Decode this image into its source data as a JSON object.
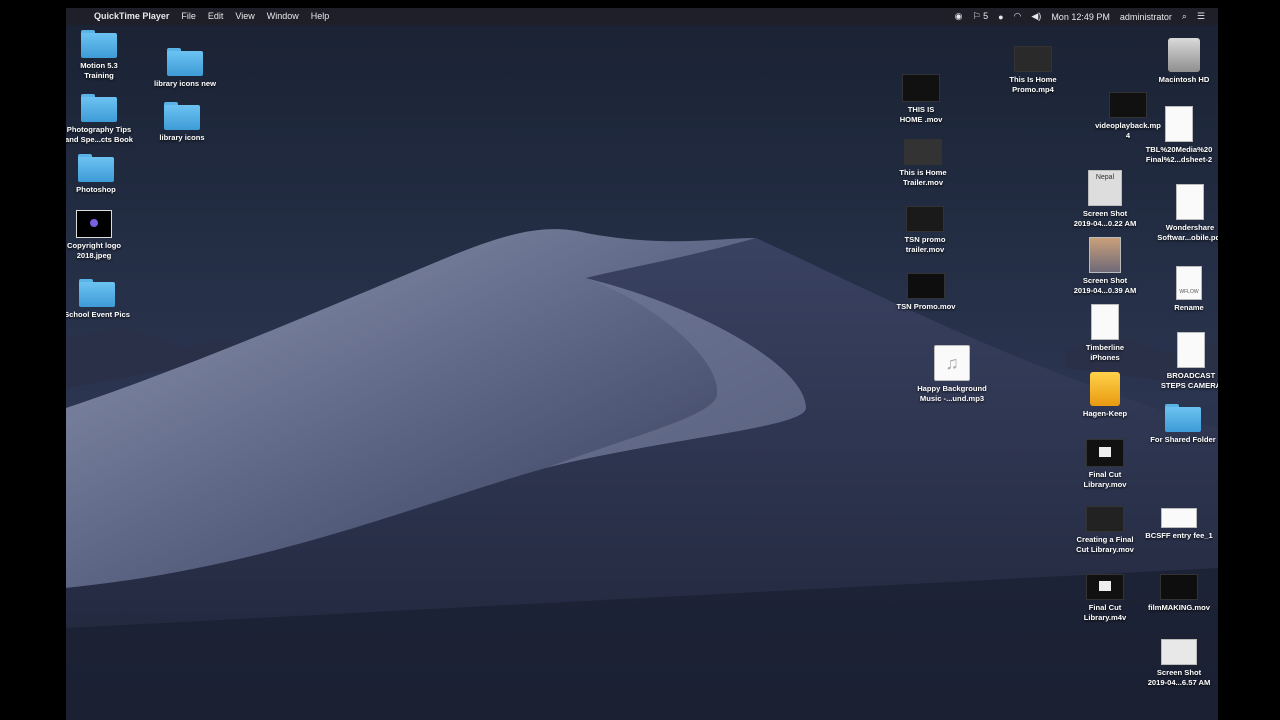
{
  "menubar": {
    "app": "QuickTime Player",
    "menus": [
      "File",
      "Edit",
      "View",
      "Window",
      "Help"
    ],
    "status_count": "5",
    "clock": "Mon 12:49 PM",
    "user": "administrator"
  },
  "icons": {
    "motion": "Motion 5.3\nTraining",
    "library_new": "library icons new",
    "photo_tips": "Photography Tips\nand Spe...cts Book",
    "library_icons": "library icons",
    "photoshop": "Photoshop",
    "copyright": "Copyright logo\n2018.jpeg",
    "school": "School Event Pics",
    "this_is_home_mov": "THIS IS\nHOME .mov",
    "home_promo": "This Is Home\nPromo.mp4",
    "home_trailer": "This is Home\nTrailer.mov",
    "tsn_trailer": "TSN promo\ntrailer.mov",
    "tsn_promo": "TSN Promo.mov",
    "happy_music": "Happy Background\nMusic -...und.mp3",
    "macintosh_hd": "Macintosh HD",
    "videoplayback": "videoplayback.mp\n4",
    "tbl": "TBL%20Media%20\nFinal%2...dsheet-2",
    "screenshot1": "Screen Shot\n2019-04...0.22 AM",
    "wondershare": "Wondershare\nSoftwar...obile.pdf",
    "screenshot2": "Screen Shot\n2019-04...0.39 AM",
    "rename": "Rename",
    "timberline": "Timberline\niPhones",
    "broadcast": "BROADCAST\nSTEPS CAMERA",
    "hagen": "Hagen-Keep",
    "shared": "For Shared Folder",
    "fcp_mov": "Final Cut\nLibrary.mov",
    "creating_fcp": "Creating a Final\nCut Library.mov",
    "bcsff": "BCSFF entry fee_1",
    "fcp_m4v": "Final Cut\nLibrary.m4v",
    "filmmaking": "filmMAKING.mov",
    "screenshot3": "Screen Shot\n2019-04...6.57 AM"
  },
  "glyphs": {
    "apple": "",
    "wflow": "WFLOW",
    "nepal": "Nepal"
  },
  "colors": {
    "folder": "#4fa9e2",
    "drive": "#f5a623"
  }
}
